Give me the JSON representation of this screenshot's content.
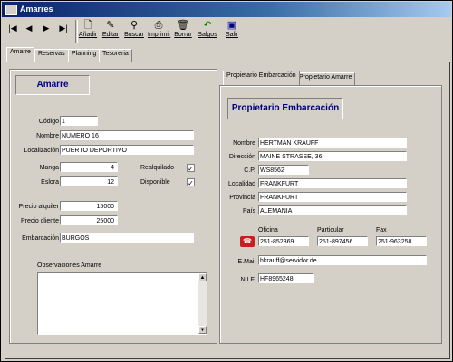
{
  "window": {
    "title": "Amarres"
  },
  "toolbar": {
    "nav": [
      "|◀",
      "◀",
      "▶",
      "▶|"
    ],
    "buttons": [
      {
        "label": "Añadir",
        "icon": "new-document-icon"
      },
      {
        "label": "Editar",
        "icon": "edit-icon"
      },
      {
        "label": "Buscar",
        "icon": "search-icon"
      },
      {
        "label": "Imprimir",
        "icon": "printer-icon"
      },
      {
        "label": "Borrar",
        "icon": "trash-icon"
      },
      {
        "label": "Salgos",
        "icon": "undo-icon"
      },
      {
        "label": "Salir",
        "icon": "exit-door-icon"
      }
    ]
  },
  "tabs": [
    "Amarre",
    "Reservas",
    "Planning",
    "Tesoreria"
  ],
  "amarre": {
    "header": "Amarre",
    "labels": {
      "codigo": "Código",
      "nombre": "Nombre",
      "localizacion": "Localización",
      "manga": "Manga",
      "eslora": "Eslora",
      "realquilado": "Realquilado",
      "disponible": "Disponible",
      "precio_alquiler": "Precio alquiler",
      "precio_cliente": "Precio cliente",
      "embarcacion": "Embarcación",
      "observaciones": "Observaciones Amarre"
    },
    "values": {
      "codigo": "1",
      "nombre": "NUMERO 16",
      "localizacion": "PUERTO DEPORTIVO",
      "manga": "4",
      "eslora": "12",
      "realquilado": "✓",
      "disponible": "✓",
      "precio_alquiler": "15000",
      "precio_cliente": "25000",
      "embarcacion": "BURGOS",
      "observaciones": ""
    }
  },
  "propietario": {
    "tabs": [
      "Propietario Embarcación",
      "Propietario Amarre"
    ],
    "header": "Propietario Embarcación",
    "labels": {
      "nombre": "Nombre",
      "direccion": "Dirección",
      "cp": "C.P.",
      "localidad": "Localidad",
      "provincia": "Provincia",
      "pais": "País",
      "oficina": "Oficina",
      "particular": "Particular",
      "fax": "Fax",
      "email": "E.Mail",
      "nif": "N.I.F."
    },
    "values": {
      "nombre": "HERTMAN KRAUFF",
      "direccion": "MAINE STRASSE, 36",
      "cp": "WS8562",
      "localidad": "FRANKFURT",
      "provincia": "FRANKFURT",
      "pais": "ALEMANIA",
      "oficina": "251-852369",
      "particular": "251-897456",
      "fax": "251-963258",
      "email": "hkrauff@servidor.de",
      "nif": "HF8965248"
    }
  }
}
